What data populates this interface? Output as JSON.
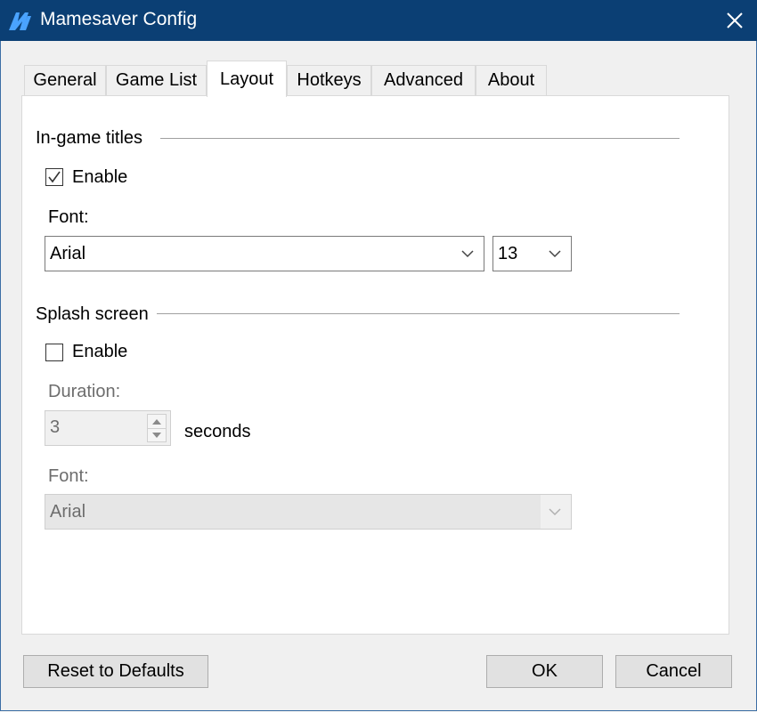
{
  "window": {
    "title": "Mamesaver Config",
    "app_icon": "mamesaver-logo-icon",
    "close_icon": "close-icon",
    "titlebar_color": "#0b3f74"
  },
  "tabs": [
    {
      "label": "General",
      "active": false
    },
    {
      "label": "Game List",
      "active": false
    },
    {
      "label": "Layout",
      "active": true
    },
    {
      "label": "Hotkeys",
      "active": false
    },
    {
      "label": "Advanced",
      "active": false
    },
    {
      "label": "About",
      "active": false
    }
  ],
  "ingame": {
    "group_label": "In-game titles",
    "enable_label": "Enable",
    "enable_checked": true,
    "font_label": "Font:",
    "font_value": "Arial",
    "size_value": "13"
  },
  "splash": {
    "group_label": "Splash screen",
    "enable_label": "Enable",
    "enable_checked": false,
    "duration_label": "Duration:",
    "duration_value": "3",
    "seconds_label": "seconds",
    "font_label": "Font:",
    "font_value": "Arial"
  },
  "buttons": {
    "reset_label": "Reset to Defaults",
    "ok_label": "OK",
    "cancel_label": "Cancel"
  }
}
